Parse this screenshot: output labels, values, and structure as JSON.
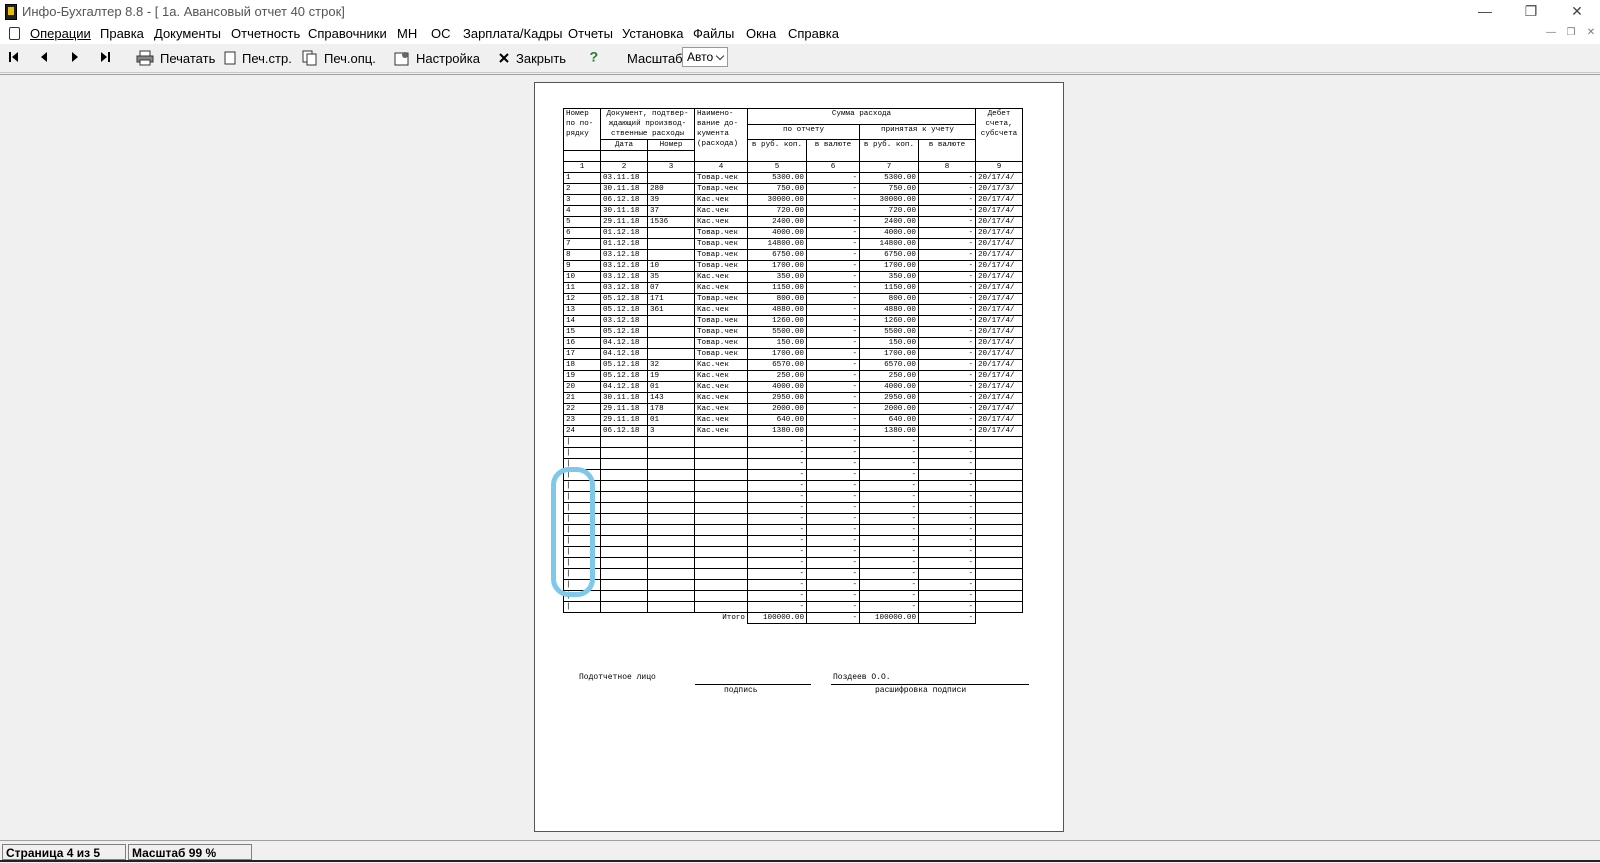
{
  "window": {
    "title": "Инфо-Бухгалтер 8.8 - [  1а. Авансовый отчет 40 строк]",
    "minimize": "—",
    "restore": "❐",
    "close": "✕"
  },
  "menu": [
    "Операции",
    "Правка",
    "Документы",
    "Отчетность",
    "Справочники",
    "МН",
    "ОС",
    "Зарплата/Кадры",
    "Отчеты",
    "Установка",
    "Файлы",
    "Окна",
    "Справка"
  ],
  "toolbar": {
    "print": "Печатать",
    "print_page": "Печ.стр.",
    "print_options": "Печ.опц.",
    "settings": "Настройка",
    "close": "Закрыть",
    "zoom_label": "Масштаб:",
    "zoom_value": "Авто"
  },
  "report": {
    "headers": {
      "h1": "Номер по по- рядку",
      "h2": "Документ, подтвер- ждающий производ- ственные расходы",
      "h2a": "Дата",
      "h2b": "Номер",
      "h4": "Наимено- вание до- кумента (расхода)",
      "h_sum": "Сумма расхода",
      "h_rep": "по отчету",
      "h_acc": "принятая к учету",
      "h5": "в руб. коп.",
      "h6": "в валюте",
      "h7": "в руб. коп.",
      "h8": "в валюте",
      "h9": "Дебет счета, субсчета"
    },
    "colnums": [
      "1",
      "2",
      "3",
      "4",
      "5",
      "6",
      "7",
      "8",
      "9"
    ],
    "rows": [
      [
        "1",
        "03.11.18",
        "",
        "Товар.чек",
        "5300.00",
        "-",
        "5300.00",
        "-",
        "20/17/4/"
      ],
      [
        "2",
        "30.11.18",
        "280",
        "Товар.чек",
        "750.00",
        "-",
        "750.00",
        "-",
        "20/17/3/"
      ],
      [
        "3",
        "06.12.18",
        "39",
        "Кас.чек",
        "30000.00",
        "-",
        "30000.00",
        "-",
        "20/17/4/"
      ],
      [
        "4",
        "30.11.18",
        "37",
        "Кас.чек",
        "720.00",
        "-",
        "720.00",
        "-",
        "20/17/4/"
      ],
      [
        "5",
        "29.11.18",
        "1536",
        "Кас.чек",
        "2400.00",
        "-",
        "2400.00",
        "-",
        "20/17/4/"
      ],
      [
        "6",
        "01.12.18",
        "",
        "Товар.чек",
        "4000.00",
        "-",
        "4000.00",
        "-",
        "20/17/4/"
      ],
      [
        "7",
        "01.12.18",
        "",
        "Товар.чек",
        "14800.00",
        "-",
        "14800.00",
        "-",
        "20/17/4/"
      ],
      [
        "8",
        "03.12.18",
        "",
        "Товар.чек",
        "6750.00",
        "-",
        "6750.00",
        "-",
        "20/17/4/"
      ],
      [
        "9",
        "03.12.18",
        "10",
        "Товар.чек",
        "1700.00",
        "-",
        "1700.00",
        "-",
        "20/17/4/"
      ],
      [
        "10",
        "03.12.18",
        "35",
        "Кас.чек",
        "350.00",
        "-",
        "350.00",
        "-",
        "20/17/4/"
      ],
      [
        "11",
        "03.12.18",
        "07",
        "Кас.чек",
        "1150.00",
        "-",
        "1150.00",
        "-",
        "20/17/4/"
      ],
      [
        "12",
        "05.12.18",
        "171",
        "Товар.чек",
        "800.00",
        "-",
        "800.00",
        "-",
        "20/17/4/"
      ],
      [
        "13",
        "05.12.18",
        "361",
        "Кас.чек",
        "4880.00",
        "-",
        "4880.00",
        "-",
        "20/17/4/"
      ],
      [
        "14",
        "03.12.18",
        "",
        "Товар.чек",
        "1260.00",
        "-",
        "1260.00",
        "-",
        "20/17/4/"
      ],
      [
        "15",
        "05.12.18",
        "",
        "Товар.чек",
        "5500.00",
        "-",
        "5500.00",
        "-",
        "20/17/4/"
      ],
      [
        "16",
        "04.12.18",
        "",
        "Товар.чек",
        "150.00",
        "-",
        "150.00",
        "-",
        "20/17/4/"
      ],
      [
        "17",
        "04.12.18",
        "",
        "Товар.чек",
        "1700.00",
        "-",
        "1700.00",
        "-",
        "20/17/4/"
      ],
      [
        "18",
        "05.12.18",
        "32",
        "Кас.чек",
        "6570.00",
        "-",
        "6570.00",
        "-",
        "20/17/4/"
      ],
      [
        "19",
        "05.12.18",
        "19",
        "Кас.чек",
        "250.00",
        "-",
        "250.00",
        "-",
        "20/17/4/"
      ],
      [
        "20",
        "04.12.18",
        "01",
        "Кас.чек",
        "4000.00",
        "-",
        "4000.00",
        "-",
        "20/17/4/"
      ],
      [
        "21",
        "30.11.18",
        "143",
        "Кас.чек",
        "2950.00",
        "-",
        "2950.00",
        "-",
        "20/17/4/"
      ],
      [
        "22",
        "29.11.18",
        "178",
        "Кас.чек",
        "2000.00",
        "-",
        "2000.00",
        "-",
        "20/17/4/"
      ],
      [
        "23",
        "29.11.18",
        "01",
        "Кас.чек",
        "640.00",
        "-",
        "640.00",
        "-",
        "20/17/4/"
      ],
      [
        "24",
        "06.12.18",
        "3",
        "Кас.чек",
        "1380.00",
        "-",
        "1380.00",
        "-",
        "20/17/4/"
      ],
      [
        "|",
        "",
        "",
        "",
        "-",
        "-",
        "-",
        "-",
        ""
      ],
      [
        "|",
        "",
        "",
        "",
        "-",
        "-",
        "-",
        "-",
        ""
      ],
      [
        "|",
        "",
        "",
        "",
        "-",
        "-",
        "-",
        "-",
        ""
      ],
      [
        "|",
        "",
        "",
        "",
        "-",
        "-",
        "-",
        "-",
        ""
      ],
      [
        "|",
        "",
        "",
        "",
        "-",
        "-",
        "-",
        "-",
        ""
      ],
      [
        "|",
        "",
        "",
        "",
        "-",
        "-",
        "-",
        "-",
        ""
      ],
      [
        "|",
        "",
        "",
        "",
        "-",
        "-",
        "-",
        "-",
        ""
      ],
      [
        "|",
        "",
        "",
        "",
        "-",
        "-",
        "-",
        "-",
        ""
      ],
      [
        "|",
        "",
        "",
        "",
        "-",
        "-",
        "-",
        "-",
        ""
      ],
      [
        "|",
        "",
        "",
        "",
        "-",
        "-",
        "-",
        "-",
        ""
      ],
      [
        "|",
        "",
        "",
        "",
        "-",
        "-",
        "-",
        "-",
        ""
      ],
      [
        "|",
        "",
        "",
        "",
        "-",
        "-",
        "-",
        "-",
        ""
      ],
      [
        "|",
        "",
        "",
        "",
        "-",
        "-",
        "-",
        "-",
        ""
      ],
      [
        "|",
        "",
        "",
        "",
        "-",
        "-",
        "-",
        "-",
        ""
      ],
      [
        "|",
        "",
        "",
        "",
        "-",
        "-",
        "-",
        "-",
        ""
      ],
      [
        "|",
        "",
        "",
        "",
        "-",
        "-",
        "-",
        "-",
        ""
      ]
    ],
    "total": {
      "label": "Итого",
      "v5": "100000.00",
      "v6": "-",
      "v7": "100000.00",
      "v8": "-"
    },
    "signature": {
      "person_label": "Подотчетное лицо",
      "signature_caption": "подпись",
      "name": "Поздеев О.О.",
      "name_caption": "расшифровка подписи"
    }
  },
  "annotation_color": "#7ec8ec",
  "status": {
    "page": "Страница 4 из 5",
    "zoom": "Масштаб 99 %"
  }
}
